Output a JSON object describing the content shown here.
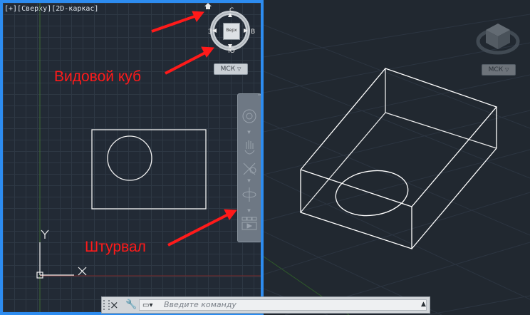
{
  "viewport_left": {
    "label": "[+][Сверху][2D-каркас]",
    "axis_x_label": "X",
    "axis_y_label": "Y"
  },
  "viewcube_left": {
    "top_label": "Верх",
    "north": "С",
    "south": "Ю",
    "west": "З",
    "east": "В",
    "ucs_button": "МСК"
  },
  "viewcube_right": {
    "ucs_button": "МСК"
  },
  "annotations": {
    "viewcube_label": "Видовой куб",
    "navbar_label": "Штурвал"
  },
  "command_line": {
    "placeholder": "Введите команду",
    "close_icon": "×",
    "settings_icon": "wrench-icon"
  },
  "colors": {
    "active_border": "#2d8cf0",
    "annotation": "#ff1a1a",
    "wireframe": "#ffffff"
  }
}
